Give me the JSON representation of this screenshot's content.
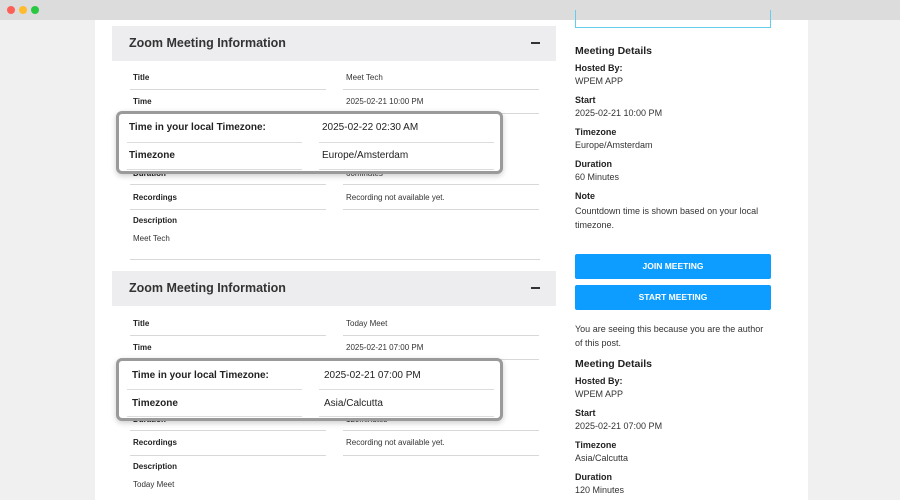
{
  "meetings": [
    {
      "header": "Zoom Meeting Information",
      "rows": [
        {
          "label": "Title",
          "value": "Meet Tech"
        },
        {
          "label": "Time",
          "value": "2025-02-21 10:00 PM"
        },
        {
          "label": "Duration",
          "value": "60minutes"
        },
        {
          "label": "Recordings",
          "value": "Recording not available yet."
        }
      ],
      "description_label": "Description",
      "description": "Meet Tech",
      "popup": {
        "local_label": "Time in your local Timezone:",
        "local_value": "2025-02-22 02:30 AM",
        "tz_label": "Timezone",
        "tz_value": "Europe/Amsterdam"
      }
    },
    {
      "header": "Zoom Meeting Information",
      "rows": [
        {
          "label": "Title",
          "value": "Today Meet"
        },
        {
          "label": "Time",
          "value": "2025-02-21 07:00 PM"
        },
        {
          "label": "Duration",
          "value": "120minutes"
        },
        {
          "label": "Recordings",
          "value": "Recording not available yet."
        }
      ],
      "description_label": "Description",
      "description": "Today Meet",
      "popup": {
        "local_label": "Time in your local Timezone:",
        "local_value": "2025-02-21 07:00 PM",
        "tz_label": "Timezone",
        "tz_value": "Asia/Calcutta"
      }
    }
  ],
  "sidebar": {
    "details1": {
      "heading": "Meeting Details",
      "hosted_by_label": "Hosted By:",
      "hosted_by": "WPEM APP",
      "start_label": "Start",
      "start": "2025-02-21 10:00 PM",
      "timezone_label": "Timezone",
      "timezone": "Europe/Amsterdam",
      "duration_label": "Duration",
      "duration": "60 Minutes",
      "note_label": "Note",
      "note": "Countdown time is shown based on your local timezone."
    },
    "join_button": "JOIN MEETING",
    "start_button": "START MEETING",
    "author_note": "You are seeing this because you are the author of this post.",
    "details2": {
      "heading": "Meeting Details",
      "hosted_by_label": "Hosted By:",
      "hosted_by": "WPEM APP",
      "start_label": "Start",
      "start": "2025-02-21 07:00 PM",
      "timezone_label": "Timezone",
      "timezone": "Asia/Calcutta",
      "duration_label": "Duration",
      "duration": "120 Minutes"
    }
  }
}
